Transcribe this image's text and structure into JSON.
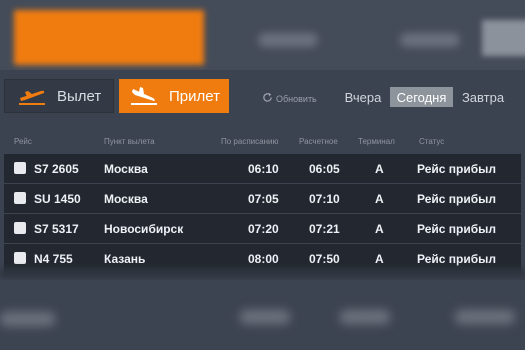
{
  "tabs": {
    "departures_label": "Вылет",
    "arrivals_label": "Прилет",
    "active": "arrivals"
  },
  "toolbar": {
    "refresh_label": "Обновить"
  },
  "days": {
    "yesterday": "Вчера",
    "today": "Сегодня",
    "tomorrow": "Завтра",
    "selected": "today"
  },
  "columns": {
    "flight": "Рейс",
    "origin": "Пункт вылета",
    "scheduled": "По расписанию",
    "estimated": "Расчетное",
    "terminal": "Терминал",
    "status": "Статус"
  },
  "rows": [
    {
      "flight": "S7 2605",
      "origin": "Москва",
      "scheduled": "06:10",
      "estimated": "06:05",
      "terminal": "A",
      "status": "Рейс прибыл"
    },
    {
      "flight": "SU 1450",
      "origin": "Москва",
      "scheduled": "07:05",
      "estimated": "07:10",
      "terminal": "A",
      "status": "Рейс прибыл"
    },
    {
      "flight": "S7 5317",
      "origin": "Новосибирск",
      "scheduled": "07:20",
      "estimated": "07:21",
      "terminal": "A",
      "status": "Рейс прибыл"
    },
    {
      "flight": "N4 755",
      "origin": "Казань",
      "scheduled": "08:00",
      "estimated": "07:50",
      "terminal": "A",
      "status": "Рейс прибыл"
    }
  ],
  "colors": {
    "accent": "#f07c10",
    "background": "#3b4250",
    "row": "#232830"
  }
}
